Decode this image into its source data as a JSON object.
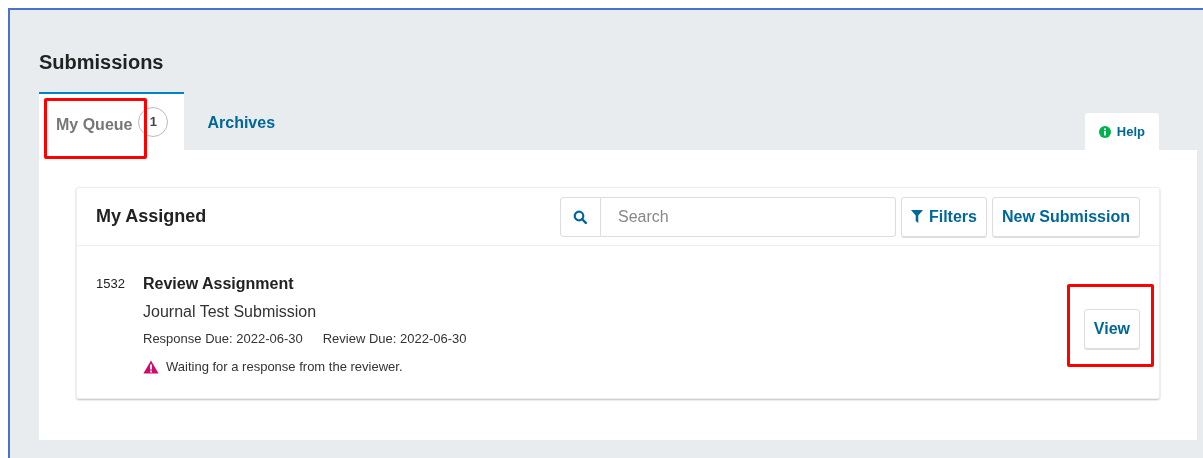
{
  "title": "Submissions",
  "tabs": [
    {
      "label": "My Queue",
      "count": "1",
      "selected": true,
      "highlighted": true
    },
    {
      "label": "Archives",
      "selected": false,
      "highlighted": false
    }
  ],
  "help": "Help",
  "list": {
    "title": "My Assigned",
    "search": {
      "placeholder": "Search"
    },
    "buttons": [
      "Filters",
      "New Submission"
    ],
    "items": [
      {
        "id": "1532",
        "type": "Review Assignment",
        "title": "Journal Test Submission",
        "dates": [
          "Response Due: 2022-06-30",
          "Review Due: 2022-06-30"
        ],
        "notice": "Waiting for a response from the reviewer.",
        "action": "View",
        "action_highlighted": true
      }
    ]
  }
}
